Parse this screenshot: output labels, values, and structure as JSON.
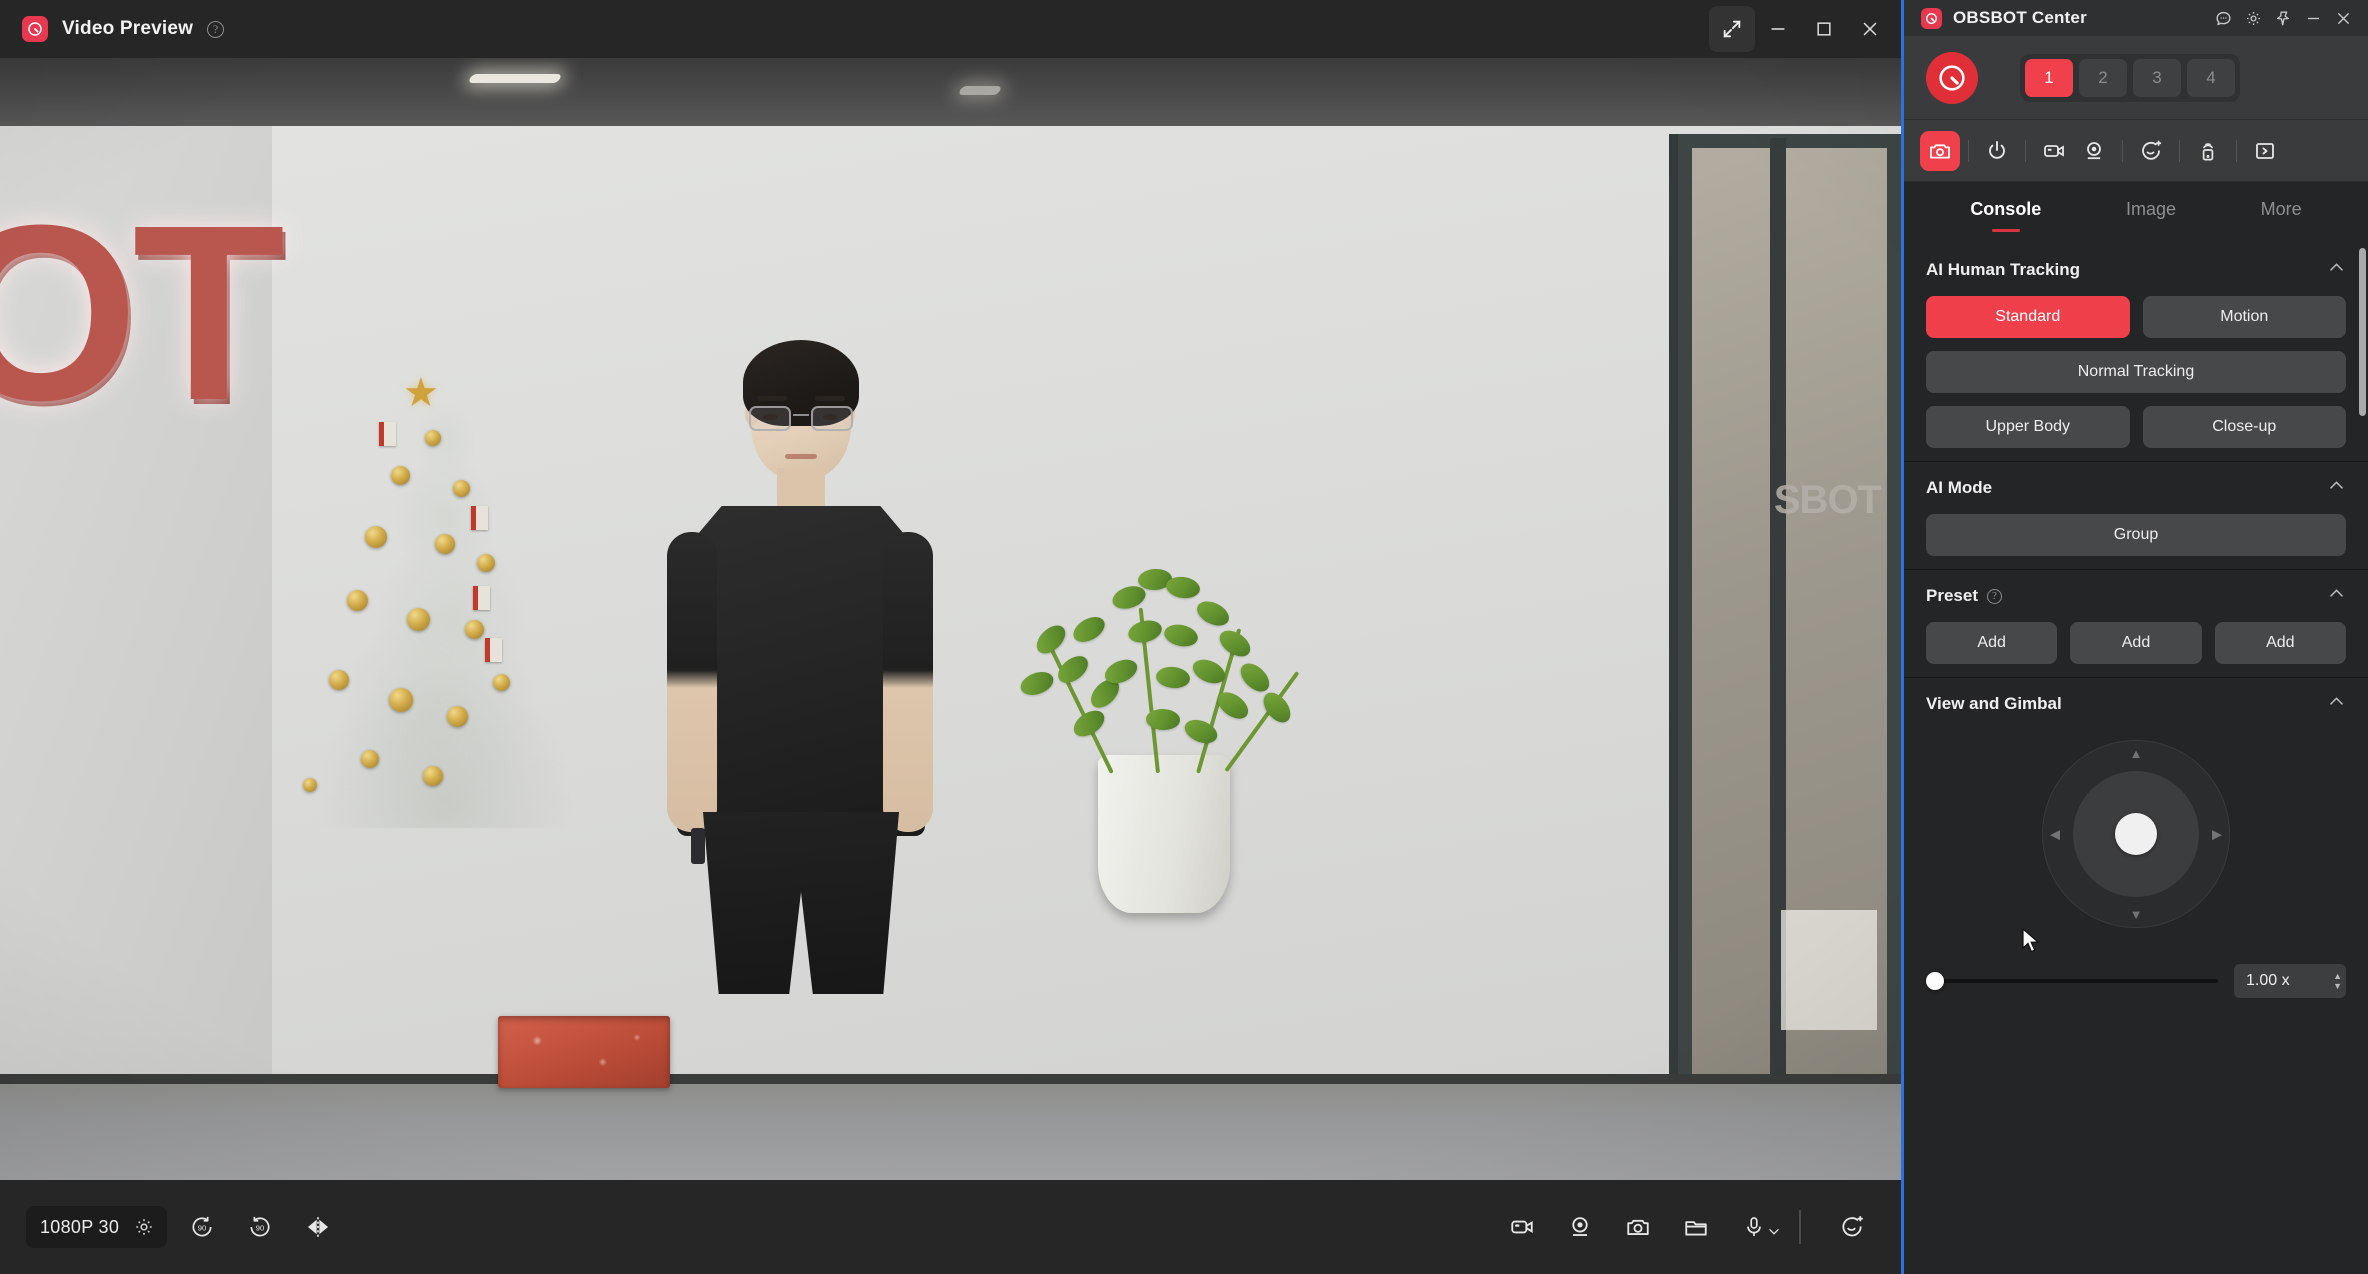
{
  "preview_window": {
    "title": "Video Preview",
    "app_icon": "obsbot-logo-icon",
    "help_icon": "help-circle-icon",
    "titlebar_buttons": [
      {
        "name": "fullscreen-expand-button",
        "icon": "expand-corners-icon"
      },
      {
        "name": "minimize-button",
        "icon": "minimize-icon"
      },
      {
        "name": "maximize-button",
        "icon": "maximize-square-icon"
      },
      {
        "name": "close-button",
        "icon": "close-x-icon"
      }
    ],
    "scene": {
      "wall_logo_text": "OT",
      "door_reflection_text": "SBOT"
    },
    "control_bar": {
      "resolution_label": "1080P 30",
      "settings_icon": "gear-icon",
      "left_buttons": [
        {
          "name": "rotate-left-90-button",
          "icon": "rotate-ccw-90-icon",
          "label": "90"
        },
        {
          "name": "rotate-right-90-button",
          "icon": "rotate-cw-90-icon",
          "label": "90"
        },
        {
          "name": "mirror-flip-button",
          "icon": "mirror-horizontal-icon"
        }
      ],
      "right_buttons": [
        {
          "name": "record-video-button",
          "icon": "video-camera-icon"
        },
        {
          "name": "webcam-mode-button",
          "icon": "webcam-icon"
        },
        {
          "name": "snapshot-button",
          "icon": "camera-icon"
        },
        {
          "name": "open-folder-button",
          "icon": "folder-icon"
        },
        {
          "name": "microphone-button",
          "icon": "microphone-icon",
          "chevron": "chevron-down-icon"
        },
        {
          "name": "ai-effects-button",
          "icon": "beauty-sparkle-icon"
        }
      ]
    }
  },
  "obsbot_center": {
    "title": "OBSBOT Center",
    "app_icon": "obsbot-logo-icon",
    "titlebar_buttons": [
      {
        "name": "feedback-button",
        "icon": "chat-bubble-icon"
      },
      {
        "name": "settings-button",
        "icon": "gear-icon"
      },
      {
        "name": "pin-window-button",
        "icon": "pin-icon"
      },
      {
        "name": "minimize-button",
        "icon": "minimize-icon"
      },
      {
        "name": "close-button",
        "icon": "close-x-icon"
      }
    ],
    "device_logo_icon": "obsbot-device-logo-icon",
    "presets": [
      {
        "label": "1",
        "active": true
      },
      {
        "label": "2",
        "active": false
      },
      {
        "label": "3",
        "active": false
      },
      {
        "label": "4",
        "active": false
      }
    ],
    "toolbar": [
      {
        "name": "toolbar-camera",
        "icon": "camera-icon",
        "active": true
      },
      {
        "name": "toolbar-power",
        "icon": "power-icon",
        "active": false
      },
      {
        "name": "toolbar-video",
        "icon": "video-camera-icon",
        "active": false
      },
      {
        "name": "toolbar-webcam",
        "icon": "webcam-icon",
        "active": false
      },
      {
        "name": "toolbar-ai-effects",
        "icon": "beauty-sparkle-icon",
        "active": false
      },
      {
        "name": "toolbar-gesture",
        "icon": "gesture-hand-icon",
        "active": false
      },
      {
        "name": "toolbar-expand",
        "icon": "expand-arrow-right-icon",
        "active": false
      }
    ],
    "tabs": [
      {
        "label": "Console",
        "active": true
      },
      {
        "label": "Image",
        "active": false
      },
      {
        "label": "More",
        "active": false
      }
    ],
    "sections": {
      "ai_human_tracking": {
        "title": "AI Human Tracking",
        "collapse_icon": "chevron-up-icon",
        "mode_buttons": [
          {
            "label": "Standard",
            "active": true
          },
          {
            "label": "Motion",
            "active": false
          }
        ],
        "tracking_button": {
          "label": "Normal Tracking",
          "active": false
        },
        "framing_buttons": [
          {
            "label": "Upper Body",
            "active": false
          },
          {
            "label": "Close-up",
            "active": false
          }
        ]
      },
      "ai_mode": {
        "title": "AI Mode",
        "collapse_icon": "chevron-up-icon",
        "buttons": [
          {
            "label": "Group",
            "active": false
          }
        ]
      },
      "preset": {
        "title": "Preset",
        "help_icon": "help-circle-icon",
        "collapse_icon": "chevron-up-icon",
        "buttons": [
          {
            "label": "Add"
          },
          {
            "label": "Add"
          },
          {
            "label": "Add"
          }
        ]
      },
      "view_and_gimbal": {
        "title": "View and Gimbal",
        "collapse_icon": "chevron-up-icon",
        "gimbal": {
          "name": "gimbal-joystick",
          "up_icon": "triangle-up-icon",
          "down_icon": "triangle-down-icon",
          "left_icon": "triangle-left-icon",
          "right_icon": "triangle-right-icon"
        },
        "zoom": {
          "value": "1.00 x",
          "slider_percent": 0,
          "increment_icon": "triangle-up-icon",
          "decrement_icon": "triangle-down-icon"
        }
      }
    }
  },
  "colors": {
    "accent_red": "#ee3f4a",
    "brand_red": "#e8384f",
    "focus_blue": "#2b72df",
    "panel_bg": "#242526",
    "header_bg": "#3a3b3c"
  }
}
